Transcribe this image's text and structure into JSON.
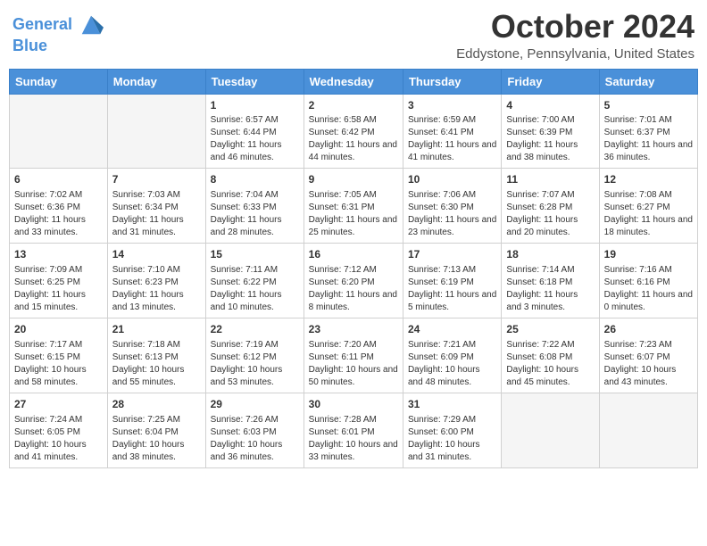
{
  "header": {
    "logo_line1": "General",
    "logo_line2": "Blue",
    "month": "October 2024",
    "location": "Eddystone, Pennsylvania, United States"
  },
  "weekdays": [
    "Sunday",
    "Monday",
    "Tuesday",
    "Wednesday",
    "Thursday",
    "Friday",
    "Saturday"
  ],
  "weeks": [
    [
      {
        "day": "",
        "sunrise": "",
        "sunset": "",
        "daylight": "",
        "empty": true
      },
      {
        "day": "",
        "sunrise": "",
        "sunset": "",
        "daylight": "",
        "empty": true
      },
      {
        "day": "1",
        "sunrise": "Sunrise: 6:57 AM",
        "sunset": "Sunset: 6:44 PM",
        "daylight": "Daylight: 11 hours and 46 minutes.",
        "empty": false
      },
      {
        "day": "2",
        "sunrise": "Sunrise: 6:58 AM",
        "sunset": "Sunset: 6:42 PM",
        "daylight": "Daylight: 11 hours and 44 minutes.",
        "empty": false
      },
      {
        "day": "3",
        "sunrise": "Sunrise: 6:59 AM",
        "sunset": "Sunset: 6:41 PM",
        "daylight": "Daylight: 11 hours and 41 minutes.",
        "empty": false
      },
      {
        "day": "4",
        "sunrise": "Sunrise: 7:00 AM",
        "sunset": "Sunset: 6:39 PM",
        "daylight": "Daylight: 11 hours and 38 minutes.",
        "empty": false
      },
      {
        "day": "5",
        "sunrise": "Sunrise: 7:01 AM",
        "sunset": "Sunset: 6:37 PM",
        "daylight": "Daylight: 11 hours and 36 minutes.",
        "empty": false
      }
    ],
    [
      {
        "day": "6",
        "sunrise": "Sunrise: 7:02 AM",
        "sunset": "Sunset: 6:36 PM",
        "daylight": "Daylight: 11 hours and 33 minutes.",
        "empty": false
      },
      {
        "day": "7",
        "sunrise": "Sunrise: 7:03 AM",
        "sunset": "Sunset: 6:34 PM",
        "daylight": "Daylight: 11 hours and 31 minutes.",
        "empty": false
      },
      {
        "day": "8",
        "sunrise": "Sunrise: 7:04 AM",
        "sunset": "Sunset: 6:33 PM",
        "daylight": "Daylight: 11 hours and 28 minutes.",
        "empty": false
      },
      {
        "day": "9",
        "sunrise": "Sunrise: 7:05 AM",
        "sunset": "Sunset: 6:31 PM",
        "daylight": "Daylight: 11 hours and 25 minutes.",
        "empty": false
      },
      {
        "day": "10",
        "sunrise": "Sunrise: 7:06 AM",
        "sunset": "Sunset: 6:30 PM",
        "daylight": "Daylight: 11 hours and 23 minutes.",
        "empty": false
      },
      {
        "day": "11",
        "sunrise": "Sunrise: 7:07 AM",
        "sunset": "Sunset: 6:28 PM",
        "daylight": "Daylight: 11 hours and 20 minutes.",
        "empty": false
      },
      {
        "day": "12",
        "sunrise": "Sunrise: 7:08 AM",
        "sunset": "Sunset: 6:27 PM",
        "daylight": "Daylight: 11 hours and 18 minutes.",
        "empty": false
      }
    ],
    [
      {
        "day": "13",
        "sunrise": "Sunrise: 7:09 AM",
        "sunset": "Sunset: 6:25 PM",
        "daylight": "Daylight: 11 hours and 15 minutes.",
        "empty": false
      },
      {
        "day": "14",
        "sunrise": "Sunrise: 7:10 AM",
        "sunset": "Sunset: 6:23 PM",
        "daylight": "Daylight: 11 hours and 13 minutes.",
        "empty": false
      },
      {
        "day": "15",
        "sunrise": "Sunrise: 7:11 AM",
        "sunset": "Sunset: 6:22 PM",
        "daylight": "Daylight: 11 hours and 10 minutes.",
        "empty": false
      },
      {
        "day": "16",
        "sunrise": "Sunrise: 7:12 AM",
        "sunset": "Sunset: 6:20 PM",
        "daylight": "Daylight: 11 hours and 8 minutes.",
        "empty": false
      },
      {
        "day": "17",
        "sunrise": "Sunrise: 7:13 AM",
        "sunset": "Sunset: 6:19 PM",
        "daylight": "Daylight: 11 hours and 5 minutes.",
        "empty": false
      },
      {
        "day": "18",
        "sunrise": "Sunrise: 7:14 AM",
        "sunset": "Sunset: 6:18 PM",
        "daylight": "Daylight: 11 hours and 3 minutes.",
        "empty": false
      },
      {
        "day": "19",
        "sunrise": "Sunrise: 7:16 AM",
        "sunset": "Sunset: 6:16 PM",
        "daylight": "Daylight: 11 hours and 0 minutes.",
        "empty": false
      }
    ],
    [
      {
        "day": "20",
        "sunrise": "Sunrise: 7:17 AM",
        "sunset": "Sunset: 6:15 PM",
        "daylight": "Daylight: 10 hours and 58 minutes.",
        "empty": false
      },
      {
        "day": "21",
        "sunrise": "Sunrise: 7:18 AM",
        "sunset": "Sunset: 6:13 PM",
        "daylight": "Daylight: 10 hours and 55 minutes.",
        "empty": false
      },
      {
        "day": "22",
        "sunrise": "Sunrise: 7:19 AM",
        "sunset": "Sunset: 6:12 PM",
        "daylight": "Daylight: 10 hours and 53 minutes.",
        "empty": false
      },
      {
        "day": "23",
        "sunrise": "Sunrise: 7:20 AM",
        "sunset": "Sunset: 6:11 PM",
        "daylight": "Daylight: 10 hours and 50 minutes.",
        "empty": false
      },
      {
        "day": "24",
        "sunrise": "Sunrise: 7:21 AM",
        "sunset": "Sunset: 6:09 PM",
        "daylight": "Daylight: 10 hours and 48 minutes.",
        "empty": false
      },
      {
        "day": "25",
        "sunrise": "Sunrise: 7:22 AM",
        "sunset": "Sunset: 6:08 PM",
        "daylight": "Daylight: 10 hours and 45 minutes.",
        "empty": false
      },
      {
        "day": "26",
        "sunrise": "Sunrise: 7:23 AM",
        "sunset": "Sunset: 6:07 PM",
        "daylight": "Daylight: 10 hours and 43 minutes.",
        "empty": false
      }
    ],
    [
      {
        "day": "27",
        "sunrise": "Sunrise: 7:24 AM",
        "sunset": "Sunset: 6:05 PM",
        "daylight": "Daylight: 10 hours and 41 minutes.",
        "empty": false
      },
      {
        "day": "28",
        "sunrise": "Sunrise: 7:25 AM",
        "sunset": "Sunset: 6:04 PM",
        "daylight": "Daylight: 10 hours and 38 minutes.",
        "empty": false
      },
      {
        "day": "29",
        "sunrise": "Sunrise: 7:26 AM",
        "sunset": "Sunset: 6:03 PM",
        "daylight": "Daylight: 10 hours and 36 minutes.",
        "empty": false
      },
      {
        "day": "30",
        "sunrise": "Sunrise: 7:28 AM",
        "sunset": "Sunset: 6:01 PM",
        "daylight": "Daylight: 10 hours and 33 minutes.",
        "empty": false
      },
      {
        "day": "31",
        "sunrise": "Sunrise: 7:29 AM",
        "sunset": "Sunset: 6:00 PM",
        "daylight": "Daylight: 10 hours and 31 minutes.",
        "empty": false
      },
      {
        "day": "",
        "sunrise": "",
        "sunset": "",
        "daylight": "",
        "empty": true
      },
      {
        "day": "",
        "sunrise": "",
        "sunset": "",
        "daylight": "",
        "empty": true
      }
    ]
  ]
}
